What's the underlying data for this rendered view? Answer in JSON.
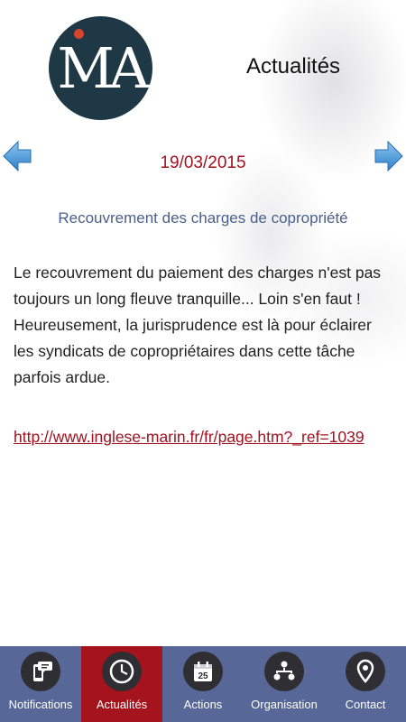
{
  "header": {
    "title": "Actualités",
    "logo_text": "MA"
  },
  "article": {
    "date": "19/03/2015",
    "title": "Recouvrement des charges de copropriété",
    "body": "Le recouvrement du paiement des charges n'est pas toujours un long fleuve tranquille... Loin s'en faut ! Heureusement, la jurisprudence est là pour éclairer les syndicats de copropriétaires dans cette tâche parfois ardue.",
    "link": "http://www.inglese-marin.fr/fr/page.htm?_ref=1039"
  },
  "tabs": [
    {
      "label": "Notifications",
      "icon": "chat-phone-icon",
      "active": false
    },
    {
      "label": "Actualités",
      "icon": "clock-icon",
      "active": true
    },
    {
      "label": "Actions",
      "icon": "calendar-icon",
      "active": false
    },
    {
      "label": "Organisation",
      "icon": "org-chart-icon",
      "active": false
    },
    {
      "label": "Contact",
      "icon": "location-pin-icon",
      "active": false
    }
  ],
  "calendar_day": "25",
  "colors": {
    "date_red": "#a0121f",
    "title_blue": "#4a5f8a",
    "tab_bar": "#576898",
    "tab_active": "#a5131d",
    "arrow_blue": "#3b8fd6"
  }
}
